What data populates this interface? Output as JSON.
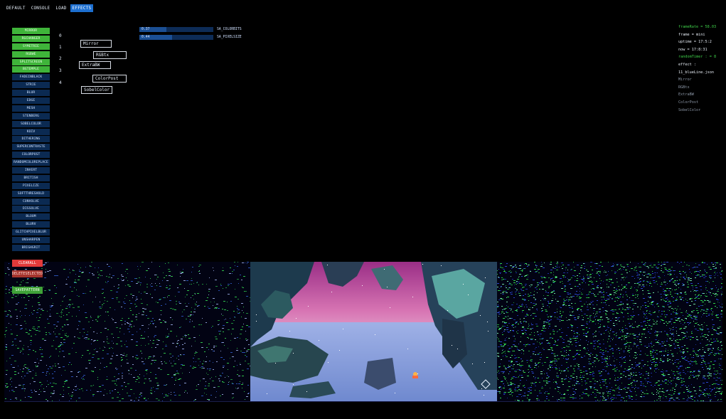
{
  "tabs": [
    {
      "label": "DEFAULT",
      "active": false
    },
    {
      "label": "CONSOLE",
      "active": false
    },
    {
      "label": "LOAD",
      "active": false
    },
    {
      "label": "EFFECTS",
      "active": true
    }
  ],
  "effects": [
    {
      "label": "MIRROR",
      "on": true
    },
    {
      "label": "RGCHANGER",
      "on": true
    },
    {
      "label": "SYMETRIE",
      "on": true
    },
    {
      "label": "RGBWE",
      "on": true
    },
    {
      "label": "SPLITSCREEN",
      "on": true
    },
    {
      "label": "BGTEMPLE",
      "on": true
    },
    {
      "label": "FADEINBLACK",
      "on": false
    },
    {
      "label": "STRIE",
      "on": false
    },
    {
      "label": "BLUR",
      "on": false
    },
    {
      "label": "EDGE",
      "on": false
    },
    {
      "label": "MESH",
      "on": false
    },
    {
      "label": "STENBERG",
      "on": false
    },
    {
      "label": "SOBELCOLOR",
      "on": false
    },
    {
      "label": "KOIV",
      "on": false
    },
    {
      "label": "DITHERING",
      "on": false
    },
    {
      "label": "SUPERCONTRASTE",
      "on": false
    },
    {
      "label": "COLORPOST",
      "on": false
    },
    {
      "label": "RANDOMCOLOREPLACE",
      "on": false
    },
    {
      "label": "INVERT",
      "on": false
    },
    {
      "label": "BRITISH",
      "on": false
    },
    {
      "label": "PIXELIZE",
      "on": false
    },
    {
      "label": "SOFTTHRESHOLD",
      "on": false
    },
    {
      "label": "CONVOLVE",
      "on": false
    },
    {
      "label": "DISSOLVE",
      "on": false
    },
    {
      "label": "BLOOM",
      "on": false
    },
    {
      "label": "BLURV",
      "on": false
    },
    {
      "label": "GLITCHPIXELBLUR",
      "on": false
    },
    {
      "label": "UNSHARPEN",
      "on": false
    },
    {
      "label": "BRIGHGRIT",
      "on": false
    }
  ],
  "stack": [
    {
      "index": "0",
      "name": "Mirror"
    },
    {
      "index": "1",
      "name": "RGBtx"
    },
    {
      "index": "2",
      "name": "ExtraBW"
    },
    {
      "index": "3",
      "name": "ColorPost"
    },
    {
      "index": "4",
      "name": "SobelColor"
    }
  ],
  "sliders": [
    {
      "value": "0.37",
      "label": "SA_COLORBITS",
      "fill_fraction": 0.37
    },
    {
      "value": "0.44",
      "label": "SA_PIXELSIZE",
      "fill_fraction": 0.44
    }
  ],
  "info": {
    "framerate": "frameRate = 58.03",
    "frame": "frame = mini",
    "uptime": "uptime = 17:5:2",
    "now": "now = 17:8:31",
    "random_timer": "randomTimer : = 8",
    "effect_label": "effect :",
    "effect_file": "11_blueLine.json",
    "active": [
      "Mirror",
      "RGBtx",
      "ExtraBW",
      "ColorPost",
      "SobelColor"
    ]
  },
  "buttons": {
    "clear": "CLEARALL",
    "delete": "DELETESELECTED",
    "save": "SAVEPATTERN"
  },
  "colors": {
    "accent": "#1d6fd0",
    "effect_on": "#3fb43a",
    "effect_off": "#0b2a52",
    "danger": "#e23a3a",
    "info_green": "#3fd14a"
  }
}
